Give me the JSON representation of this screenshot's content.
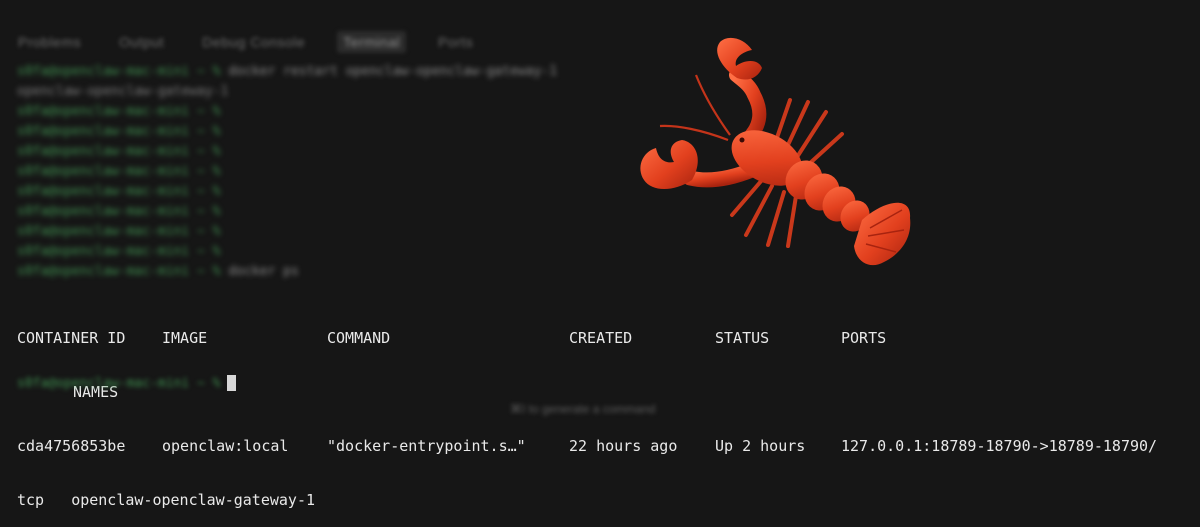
{
  "panel": {
    "tabs": [
      {
        "label": "Problems"
      },
      {
        "label": "Output"
      },
      {
        "label": "Debug Console"
      },
      {
        "label": "Terminal",
        "active": true
      },
      {
        "label": "Ports"
      }
    ]
  },
  "terminal": {
    "history": [
      {
        "prompt": "s0fa@openclaw-mac-mini ~ %",
        "cmd": "docker restart openclaw-openclaw-gateway-1"
      },
      {
        "wrap": "openclaw-openclaw-gateway-1"
      },
      {
        "prompt": "s0fa@openclaw-mac-mini ~ %",
        "cmd": ""
      },
      {
        "prompt": "s0fa@openclaw-mac-mini ~ %",
        "cmd": ""
      },
      {
        "prompt": "s0fa@openclaw-mac-mini ~ %",
        "cmd": ""
      },
      {
        "prompt": "s0fa@openclaw-mac-mini ~ %",
        "cmd": ""
      },
      {
        "prompt": "s0fa@openclaw-mac-mini ~ %",
        "cmd": ""
      },
      {
        "prompt": "s0fa@openclaw-mac-mini ~ %",
        "cmd": ""
      },
      {
        "prompt": "s0fa@openclaw-mac-mini ~ %",
        "cmd": ""
      },
      {
        "prompt": "s0fa@openclaw-mac-mini ~ %",
        "cmd": ""
      },
      {
        "prompt": "s0fa@openclaw-mac-mini ~ %",
        "cmd": "docker ps"
      }
    ],
    "docker_ps": {
      "headers": {
        "container_id": "CONTAINER ID",
        "image": "IMAGE",
        "command": "COMMAND",
        "created": "CREATED",
        "status": "STATUS",
        "ports": "PORTS",
        "names": "NAMES"
      },
      "row": {
        "container_id": "cda4756853be",
        "image": "openclaw:local",
        "command": "\"docker-entrypoint.s…\"",
        "created": "22 hours ago",
        "status": "Up 2 hours",
        "ports": "127.0.0.1:18789-18790->18789-18790/",
        "ports_wrap": "tcp",
        "names": "openclaw-openclaw-gateway-1"
      }
    },
    "current_prompt": "s0fa@openclaw-mac-mini ~ %",
    "hint": "⌘I to generate a command"
  },
  "overlay": {
    "icon": "lobster-icon",
    "colors": {
      "body": "#e2401e",
      "shade": "#a8230f",
      "highlight": "#ff6f45"
    }
  }
}
